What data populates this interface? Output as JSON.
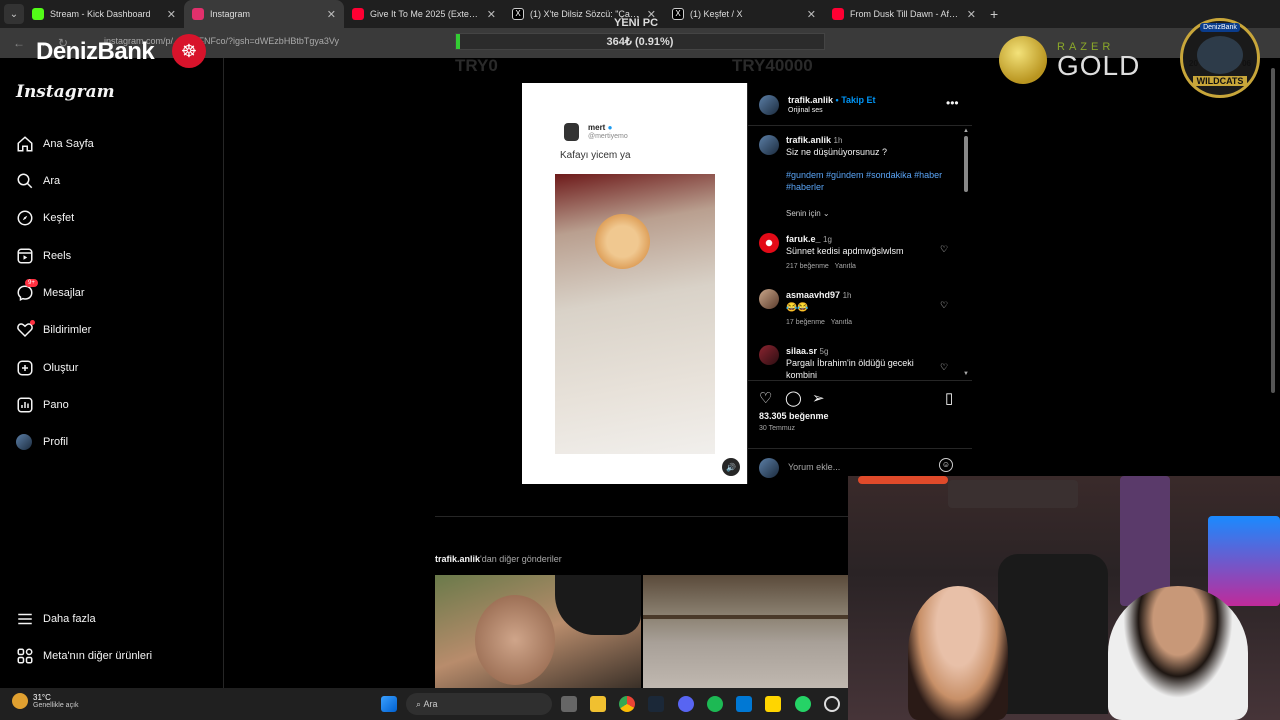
{
  "browser": {
    "tabs": [
      {
        "label": "Stream - Kick Dashboard",
        "color": "#53fc18",
        "active": false
      },
      {
        "label": "Instagram",
        "color": "#e1306c",
        "active": true
      },
      {
        "label": "Give It To Me 2025 (Extended M",
        "color": "#ff0033",
        "active": false
      },
      {
        "label": "(1) X'te Dilsiz Sözcü: \"Çağrı Me",
        "color": "#ffffff",
        "active": false
      },
      {
        "label": "(1) Keşfet / X",
        "color": "#ffffff",
        "active": false
      },
      {
        "label": "From Dusk Till Dawn - Afro/Ma",
        "color": "#ff0033",
        "active": false
      }
    ],
    "url": "instagram.com/p/...GVbFNFco/?igsh=dWEzbHBtbTgya3Vy"
  },
  "overlay": {
    "top_label": "YENİ PC",
    "progress_text": "364₺ (0.91%)",
    "progress_fraction": 0.0091,
    "left_goal": "TRY0",
    "right_goal": "TRY40000",
    "sponsor_logo": "DenizBank",
    "razer_small": "RAZER",
    "razer_big": "GOLD",
    "wildcats_top": "DenizBank",
    "wildcats_label": "WILDCATS",
    "wildcats_year_left": "20",
    "wildcats_year_right": "06"
  },
  "sidebar": {
    "logo": "Instagram",
    "items": [
      {
        "label": "Ana Sayfa",
        "icon": "home-icon"
      },
      {
        "label": "Ara",
        "icon": "search-icon"
      },
      {
        "label": "Keşfet",
        "icon": "compass-icon"
      },
      {
        "label": "Reels",
        "icon": "reels-icon"
      },
      {
        "label": "Mesajlar",
        "icon": "messenger-icon",
        "badge": "9+"
      },
      {
        "label": "Bildirimler",
        "icon": "heart-icon",
        "dot": true
      },
      {
        "label": "Oluştur",
        "icon": "plus-square-icon"
      },
      {
        "label": "Pano",
        "icon": "dashboard-icon"
      },
      {
        "label": "Profil",
        "icon": "avatar-icon"
      }
    ],
    "bottom": [
      {
        "label": "Daha fazla",
        "icon": "menu-icon"
      },
      {
        "label": "Meta'nın diğer ürünleri",
        "icon": "meta-icon"
      }
    ]
  },
  "post": {
    "tweet": {
      "name": "mert",
      "handle": "@mertiyemo",
      "text": "Kafayı yicem ya"
    },
    "author": "trafik.anlik",
    "follow_label": "Takip Et",
    "audio": "Orijinal ses",
    "caption": {
      "user": "trafik.anlik",
      "time": "1h",
      "text": "Siz ne düşünüyorsunuz ?",
      "hashtags": "#gundem #gündem #sondakika #haber #haberler"
    },
    "sort_label": "Senin için",
    "comments": [
      {
        "user": "faruk.e_",
        "time": "1g",
        "text": "Sünnet kedisi apdmwğslwlsm",
        "likes": "217 beğenme",
        "reply": "Yanıtla"
      },
      {
        "user": "asmaavhd97",
        "time": "1h",
        "text": "😂😂",
        "likes": "17 beğenme",
        "reply": "Yanıtla"
      },
      {
        "user": "silaa.sr",
        "time": "5g",
        "text": "Pargalı İbrahim'in öldüğü geceki kombini",
        "likes": "",
        "reply": ""
      }
    ],
    "like_count": "83.305 beğenme",
    "date": "30 Temmuz",
    "comment_placeholder": "Yorum ekle..."
  },
  "more_posts": {
    "user": "trafik.anlik",
    "suffix": "'dan diğer gönderiler"
  },
  "taskbar": {
    "temp": "31°C",
    "weather": "Genellikle açık",
    "search": "Ara"
  }
}
